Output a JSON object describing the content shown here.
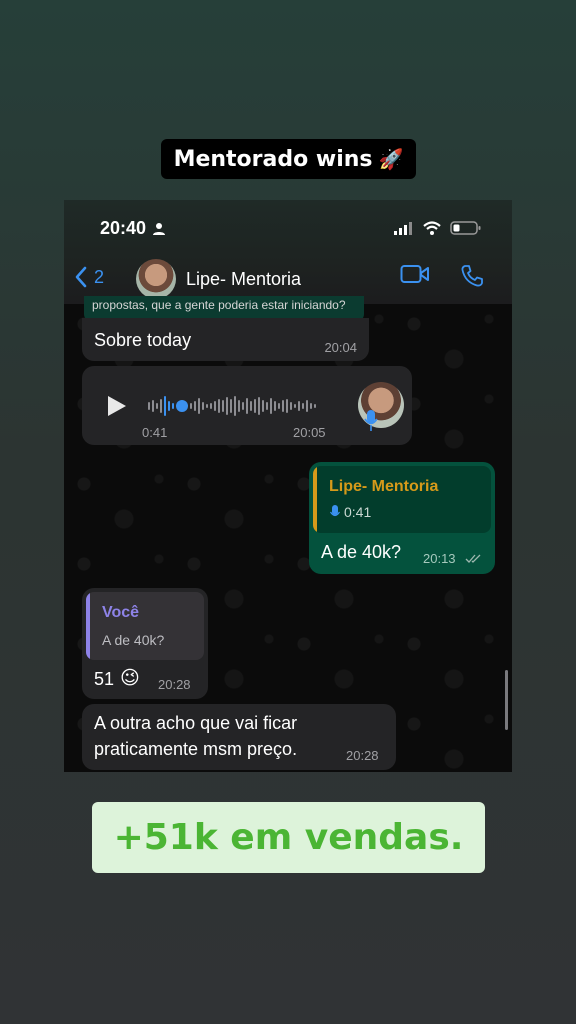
{
  "story": {
    "title": "Mentorado wins",
    "title_emoji": "🚀",
    "banner": "+51k em vendas."
  },
  "status_bar": {
    "time": "20:40"
  },
  "header": {
    "back_count": "2",
    "contact_name": "Lipe- Mentoria"
  },
  "messages": {
    "peek_quote": "propostas, que a gente poderia estar iniciando?",
    "m1": {
      "text": "Sobre today",
      "time": "20:04"
    },
    "voice": {
      "duration": "0:41",
      "time": "20:05"
    },
    "m3": {
      "quote_author": "Lipe- Mentoria",
      "quote_duration": "0:41",
      "text": "A de 40k?",
      "time": "20:13"
    },
    "m4": {
      "quote_author": "Você",
      "quote_text": "A de 40k?",
      "text": "51",
      "emoji": "😉",
      "time": "20:28"
    },
    "m5": {
      "text_line1": "A outra acho que vai ficar",
      "text_line2": "praticamente msm preço.",
      "time": "20:28"
    }
  },
  "colors": {
    "accent_blue": "#3b91f0",
    "outgoing_bubble": "#04523d",
    "incoming_bubble": "#242426",
    "quote_author_out": "#d69a1a",
    "quote_author_in": "#8e83e8",
    "banner_text": "#4bb534"
  }
}
